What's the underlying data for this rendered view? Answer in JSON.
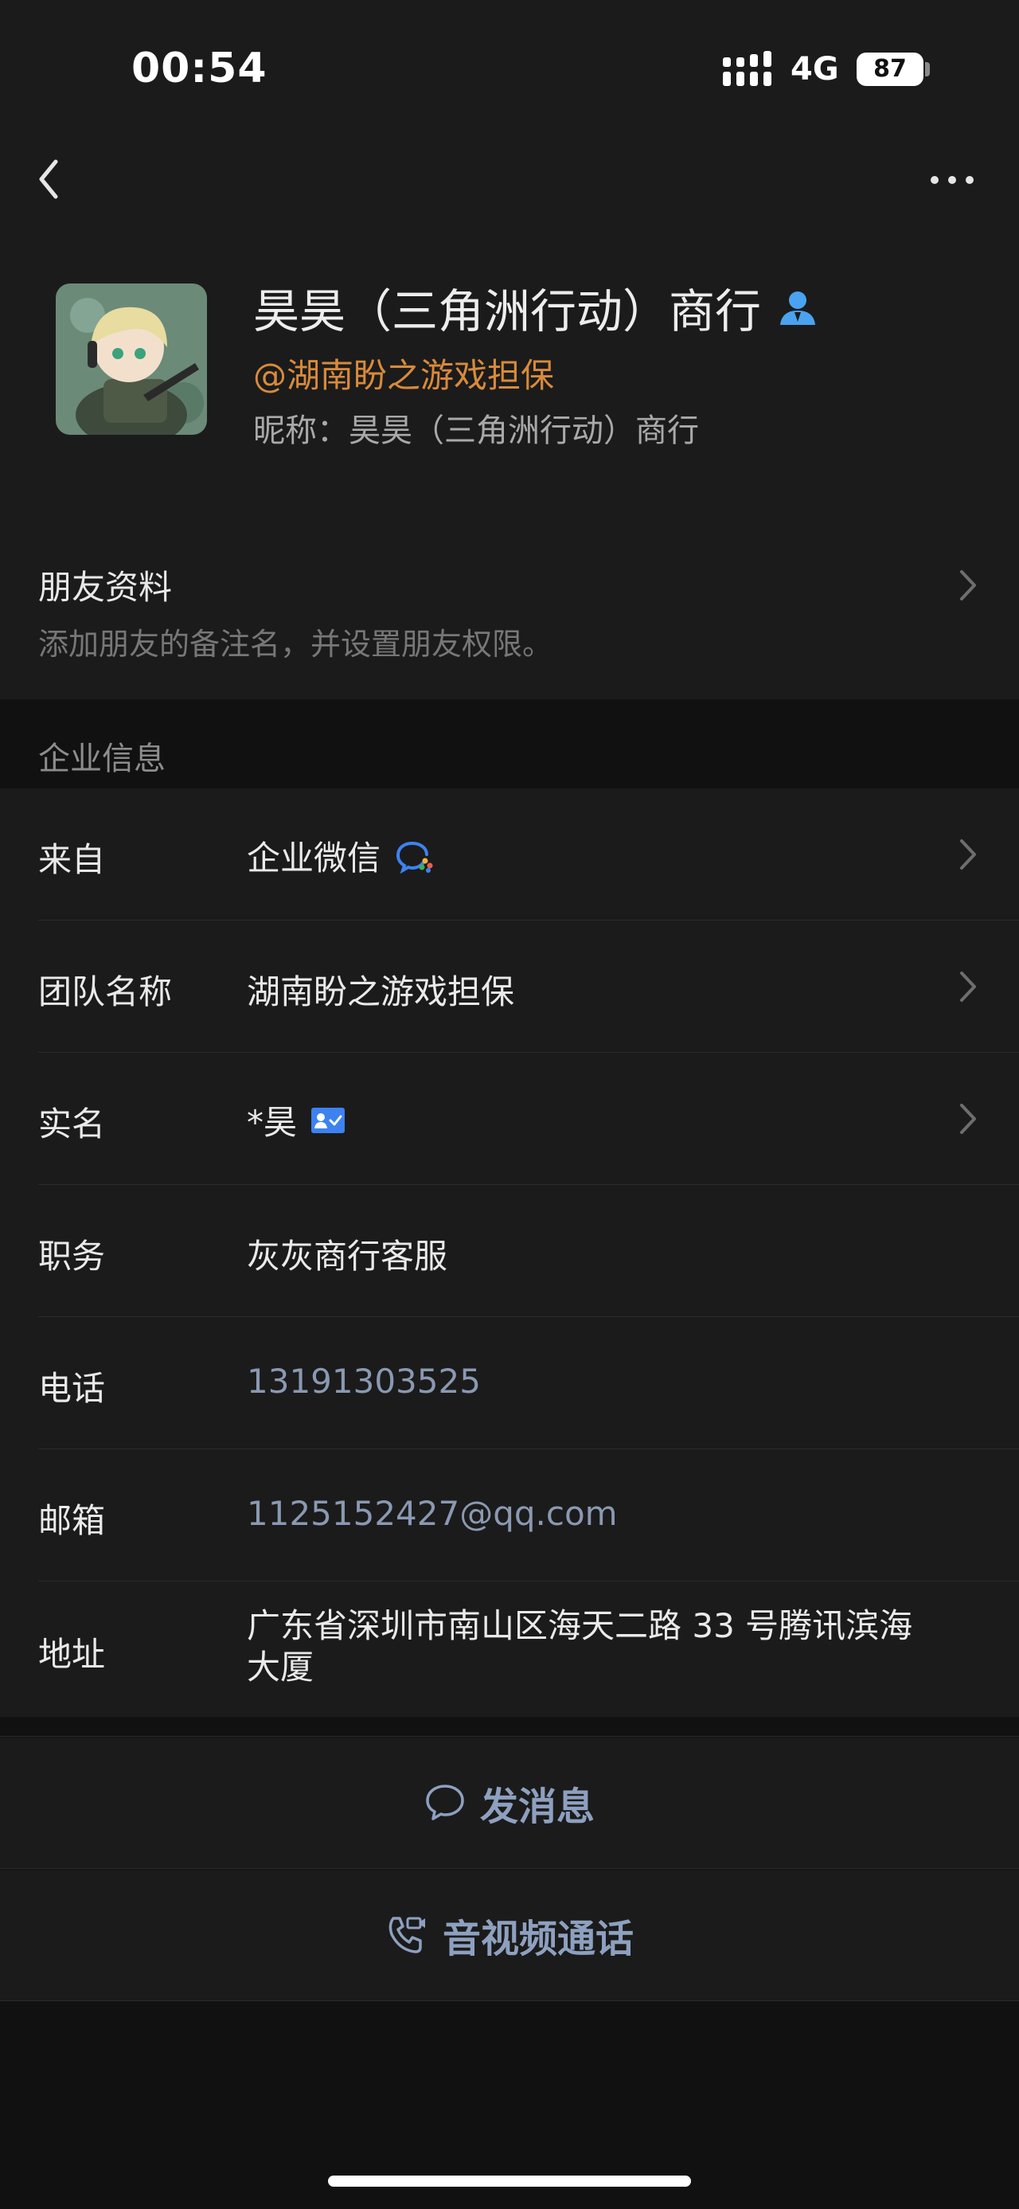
{
  "status_bar": {
    "time": "00:54",
    "network": "4G",
    "battery": "87"
  },
  "nav": {
    "back_icon": "chevron-left-icon",
    "more_icon": "more-dots-icon"
  },
  "profile": {
    "avatar_icon": "game-character-avatar",
    "name": "昊昊（三角洲行动）商行",
    "verified_user_icon": "enterprise-user-icon",
    "company_tag": "@湖南盼之游戏担保",
    "nickname_prefix": "昵称：",
    "nickname": "昊昊（三角洲行动）商行"
  },
  "friend_info": {
    "title": "朋友资料",
    "subtitle": "添加朋友的备注名，并设置朋友权限。"
  },
  "enterprise_section": {
    "title": "企业信息",
    "rows": [
      {
        "label": "来自",
        "value": "企业微信",
        "has_arrow": true
      },
      {
        "label": "团队名称",
        "value": "湖南盼之游戏担保",
        "has_arrow": true
      },
      {
        "label": "实名",
        "value": "*昊",
        "has_arrow": true
      },
      {
        "label": "职务",
        "value": "灰灰商行客服",
        "has_arrow": false
      },
      {
        "label": "电话",
        "value": "13191303525",
        "has_arrow": false
      },
      {
        "label": "邮箱",
        "value": "1125152427@qq.com",
        "has_arrow": false
      },
      {
        "label": "地址",
        "value_line1": "广东省深圳市南山区海天二路 33 号腾讯滨海",
        "value_line2": "大厦",
        "has_arrow": false
      }
    ]
  },
  "actions": {
    "message": "发消息",
    "call": "音视频通话"
  },
  "colors": {
    "background": "#111111",
    "card": "#1b1b1b",
    "company_tag": "#d88a3b",
    "link": "#8a99b2",
    "action_text": "#8ea0bf",
    "wecom_blue": "#3d82f0"
  }
}
